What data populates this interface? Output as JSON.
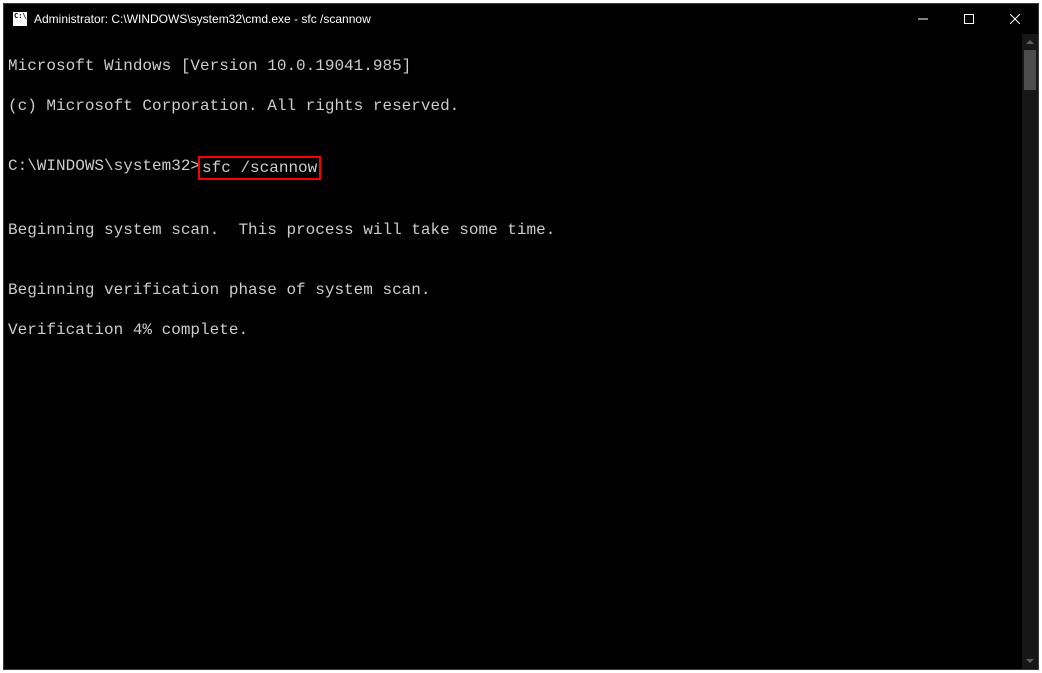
{
  "window": {
    "title": "Administrator: C:\\WINDOWS\\system32\\cmd.exe - sfc  /scannow"
  },
  "terminal": {
    "line1": "Microsoft Windows [Version 10.0.19041.985]",
    "line2": "(c) Microsoft Corporation. All rights reserved.",
    "blank1": "",
    "prompt": "C:\\WINDOWS\\system32>",
    "command": "sfc /scannow",
    "blank2": "",
    "line3": "Beginning system scan.  This process will take some time.",
    "blank3": "",
    "line4": "Beginning verification phase of system scan.",
    "line5": "Verification 4% complete."
  }
}
